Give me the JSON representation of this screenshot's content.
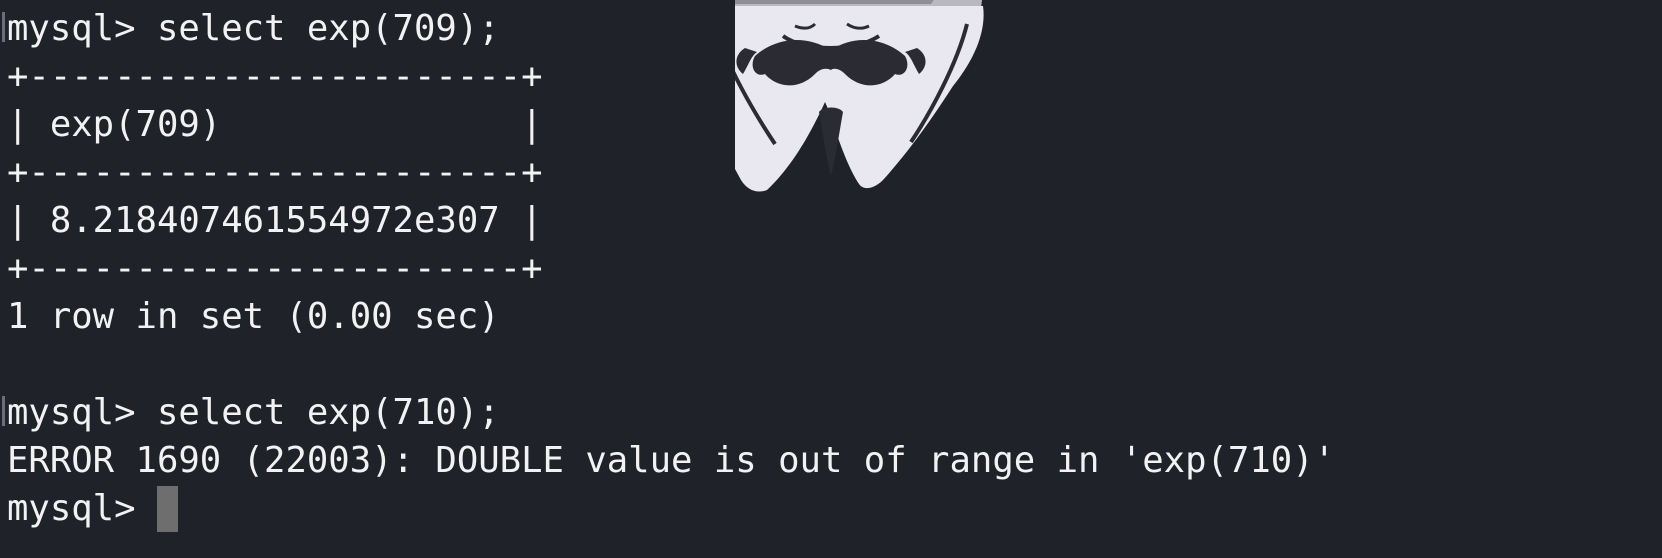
{
  "terminal": {
    "lines": [
      "mysql> select exp(709);",
      "+-----------------------+",
      "| exp(709)              |",
      "+-----------------------+",
      "| 8.218407461554972e307 |",
      "+-----------------------+",
      "1 row in set (0.00 sec)",
      "",
      "mysql> select exp(710);",
      "ERROR 1690 (22003): DOUBLE value is out of range in 'exp(710)'"
    ],
    "current_prompt": "mysql> "
  },
  "colors": {
    "background": "#20222a",
    "text": "#f2f2f2",
    "cursor": "#6e6e6e",
    "mask": "#e9e8f0"
  },
  "icons": {
    "watermark": "guy-fawkes-mask-icon"
  }
}
